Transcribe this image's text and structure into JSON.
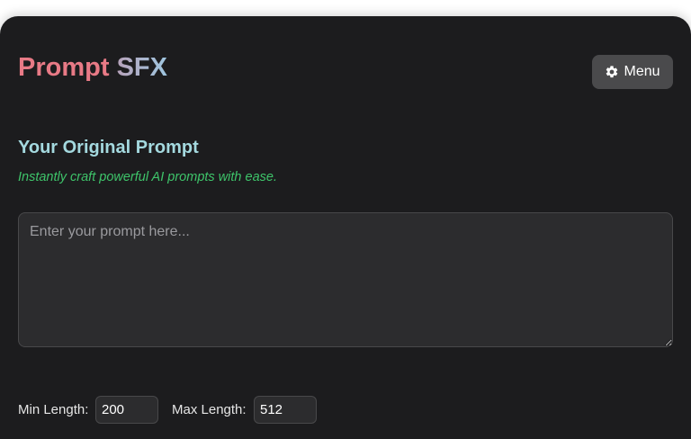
{
  "header": {
    "title_part1": "Prompt",
    "title_part2": "SFX",
    "menu_label": "Menu",
    "menu_icon": "gear-icon"
  },
  "prompt_section": {
    "heading": "Your Original Prompt",
    "tagline": "Instantly craft powerful AI prompts with ease.",
    "textarea_value": "",
    "textarea_placeholder": "Enter your prompt here..."
  },
  "length_settings": {
    "min_label": "Min Length:",
    "min_value": "200",
    "max_label": "Max Length:",
    "max_value": "512"
  },
  "colors": {
    "background": "#1c1c1e",
    "title_prompt": "#e87a86",
    "title_sfx_start": "#b7a3bb",
    "title_sfx_end": "#9fc6e0",
    "heading": "#a4d9df",
    "tagline": "#3ec46a",
    "menu_button": "#4a4a4c",
    "field": "#2c2c2e"
  }
}
